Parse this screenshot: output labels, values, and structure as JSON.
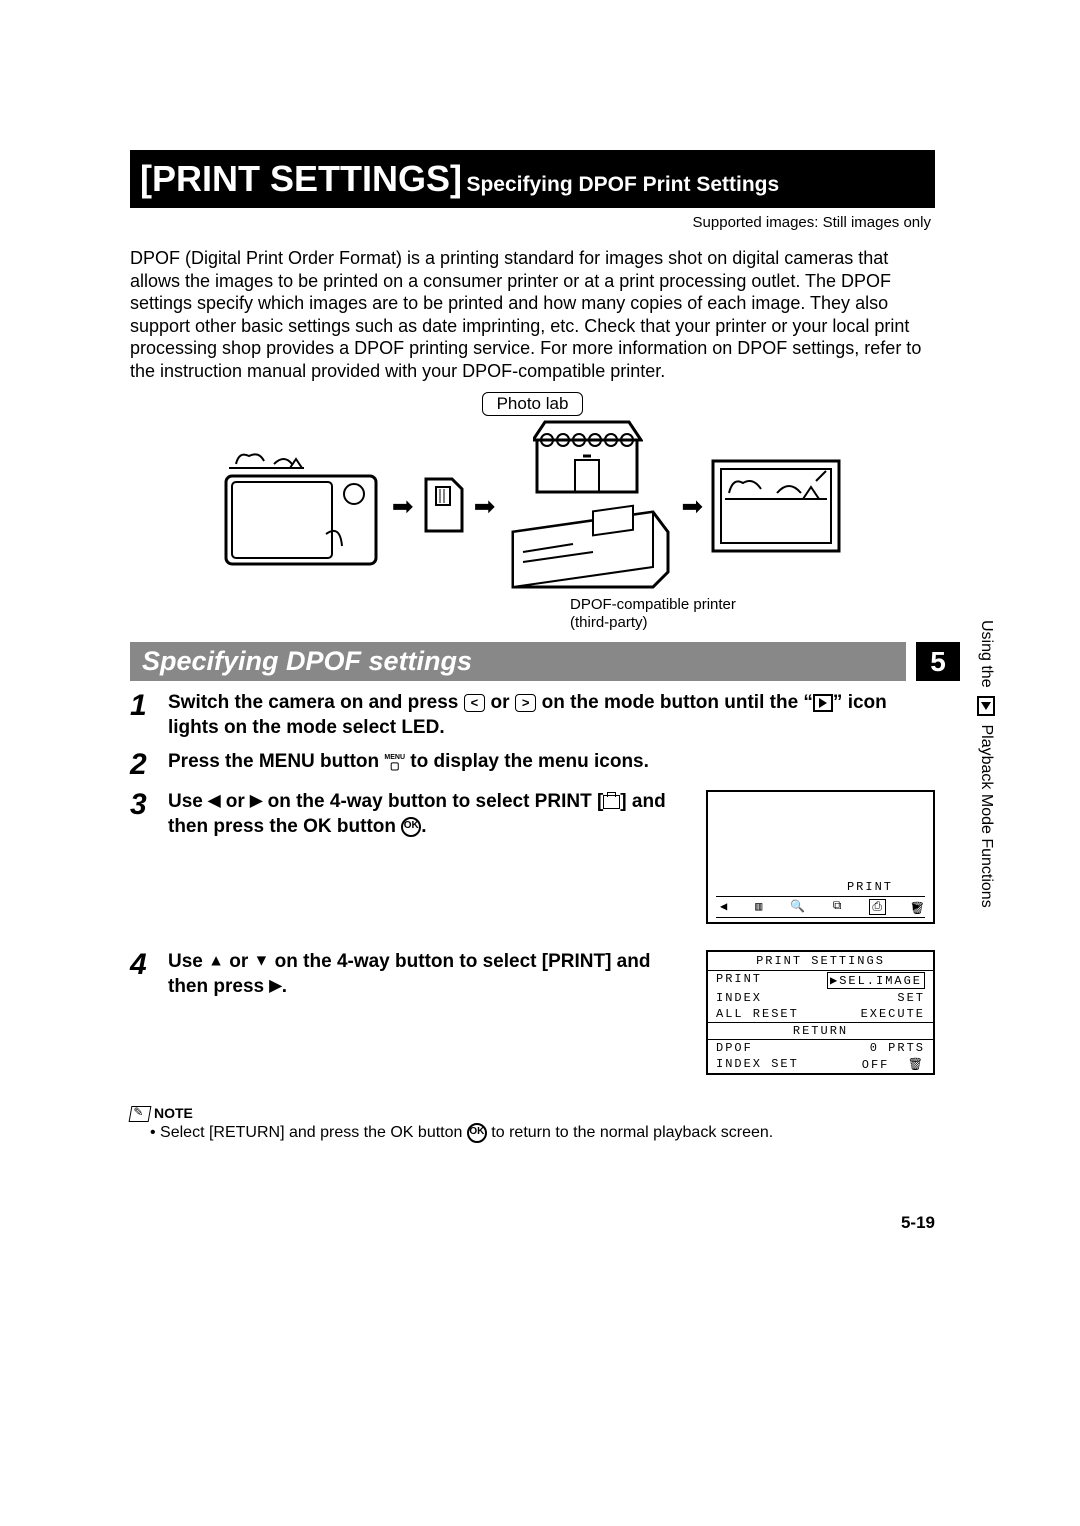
{
  "header": {
    "title_prefix": "[PRINT SETTINGS]",
    "title_suffix": "Specifying DPOF Print Settings",
    "supported": "Supported images: Still images only"
  },
  "intro": "DPOF (Digital Print Order Format) is a printing standard for images shot on digital cameras that allows the images to be printed on a consumer printer or at a print processing outlet. The DPOF settings specify which images are to be printed and how many copies of each image. They also support other basic settings such as date imprinting, etc. Check that your printer or your local print processing shop provides a DPOF printing service. For more information on DPOF settings, refer to the instruction manual provided with your DPOF-compatible printer.",
  "diagram": {
    "photolab_label": "Photo lab",
    "printer_caption_l1": "DPOF-compatible printer",
    "printer_caption_l2": "(third-party)"
  },
  "section": {
    "title": "Specifying DPOF settings",
    "chapter": "5"
  },
  "steps": {
    "s1a": "Switch the camera on and press ",
    "s1b": " or ",
    "s1c": " on the mode button until the “",
    "s1d": "” icon lights on the mode select LED.",
    "s2a": "Press the MENU button ",
    "s2b": " to display the menu icons.",
    "s3a": "Use ",
    "s3b": " or ",
    "s3c": " on the 4-way button to select PRINT [",
    "s3d": "] and then press the OK button ",
    "s3e": ".",
    "s4a": "Use ",
    "s4b": " or ",
    "s4c": " on the 4-way button to select [PRINT] and then press ",
    "s4d": "."
  },
  "screen1": {
    "label": "PRINT"
  },
  "screen2": {
    "title": "PRINT SETTINGS",
    "rows": [
      {
        "l": "PRINT",
        "r": "SEL.IMAGE",
        "sel": true
      },
      {
        "l": "INDEX",
        "r": "SET"
      },
      {
        "l": "ALL RESET",
        "r": "EXECUTE"
      }
    ],
    "return": "RETURN",
    "foot": [
      {
        "l": "DPOF",
        "r": "0 PRTS"
      },
      {
        "l": "INDEX SET",
        "r": "OFF"
      }
    ]
  },
  "note": {
    "head": "NOTE",
    "body_a": "Select [RETURN] and press the OK button ",
    "body_b": " to return to the normal playback screen."
  },
  "sidebar": {
    "a": "Using the ",
    "b": " Playback Mode Functions"
  },
  "pagenum": "5-19"
}
